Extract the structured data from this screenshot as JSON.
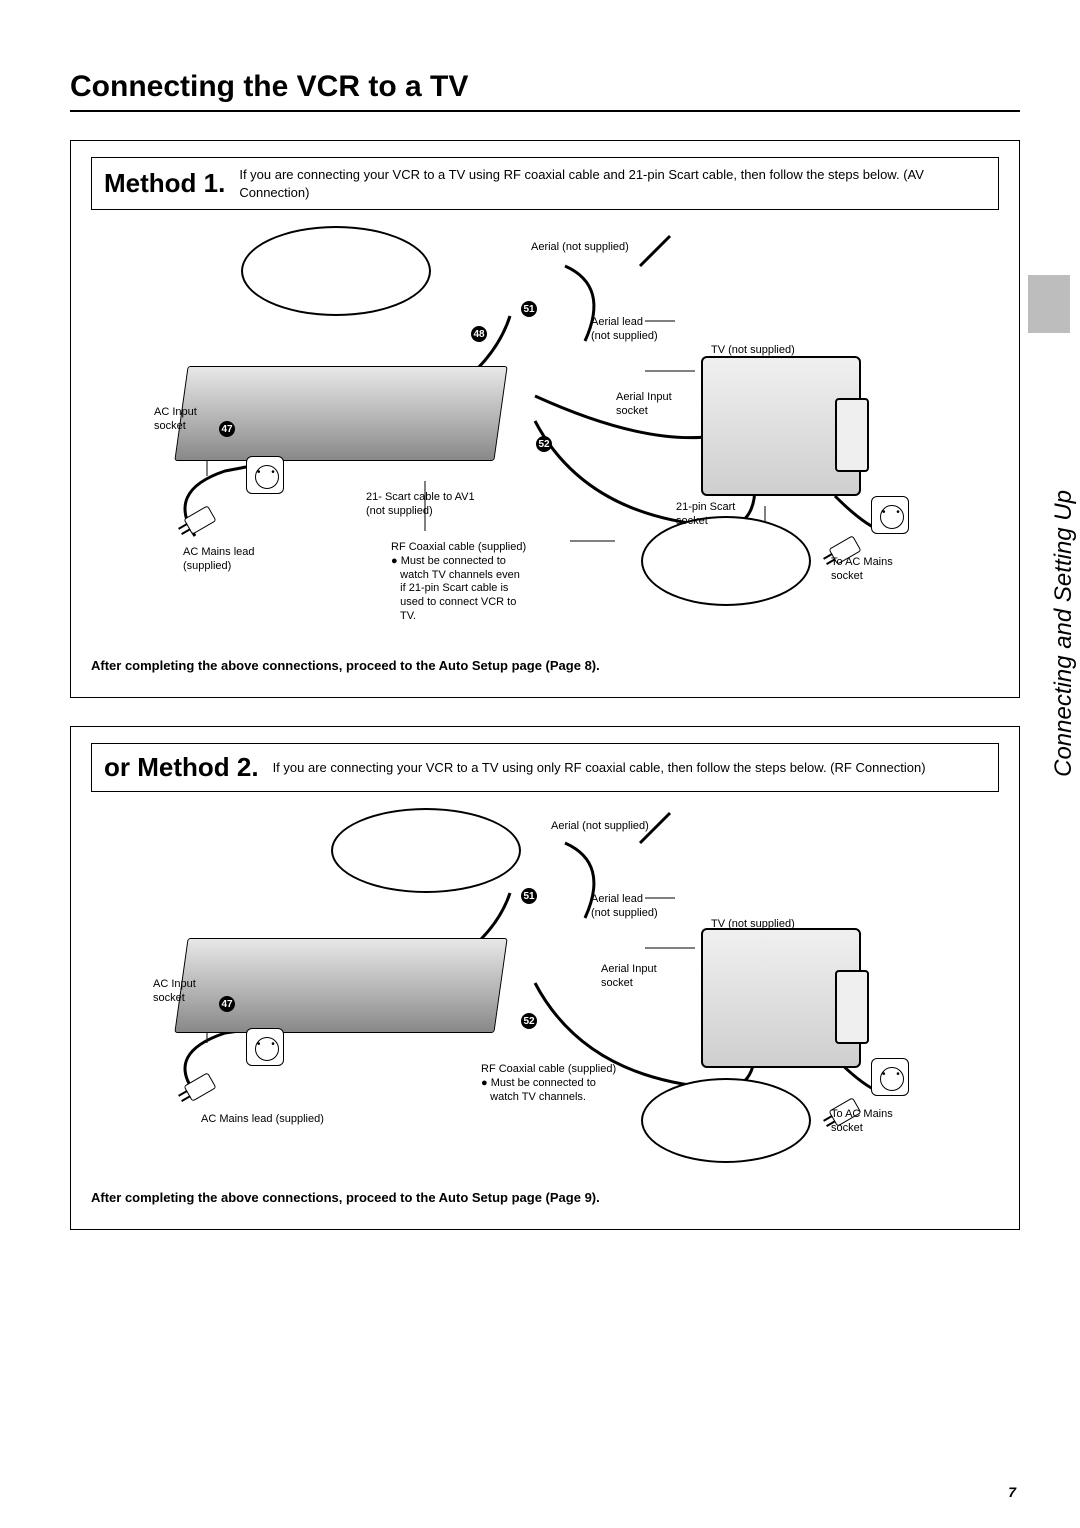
{
  "page_title": "Connecting the VCR to a TV",
  "side_label": "Connecting and Setting Up",
  "page_number": "7",
  "method1": {
    "title": "Method 1.",
    "description": "If you are connecting your VCR to a TV using RF coaxial cable and 21-pin Scart cable, then follow the steps below. (AV Connection)",
    "labels": {
      "aerial": "Aerial (not supplied)",
      "aerial_lead": "Aerial lead\n(not supplied)",
      "tv": "TV (not supplied)",
      "aerial_input": "Aerial Input\nsocket",
      "scart_socket": "21-pin Scart\nsocket",
      "ac_input": "AC Input\nsocket",
      "ac_mains_lead": "AC Mains lead\n(supplied)",
      "scart_cable": "21- Scart cable to AV1\n(not supplied)",
      "rf_cable": "RF Coaxial cable (supplied)\n● Must be connected to\n   watch TV channels even\n   if 21-pin Scart cable is\n   used to connect VCR to\n   TV.",
      "to_ac": "To AC Mains\nsocket",
      "n47": "47",
      "n48": "48",
      "n51": "51",
      "n52": "52"
    },
    "footer": "After completing the above connections, proceed to the Auto Setup page (Page 8)."
  },
  "method2": {
    "title": "or Method 2.",
    "description": "If you are connecting your VCR to a TV using only RF coaxial cable, then follow the steps below. (RF Connection)",
    "labels": {
      "aerial": "Aerial (not supplied)",
      "aerial_lead": "Aerial lead\n(not supplied)",
      "tv": "TV (not supplied)",
      "aerial_input": "Aerial Input\nsocket",
      "ac_input": "AC Input\nsocket",
      "ac_mains_lead": "AC Mains lead (supplied)",
      "rf_cable": "RF Coaxial cable (supplied)\n● Must be connected to\n   watch TV channels.",
      "to_ac": "To AC Mains\nsocket",
      "n47": "47",
      "n51": "51",
      "n52": "52"
    },
    "footer": "After completing the above connections, proceed to the Auto Setup page (Page 9)."
  }
}
